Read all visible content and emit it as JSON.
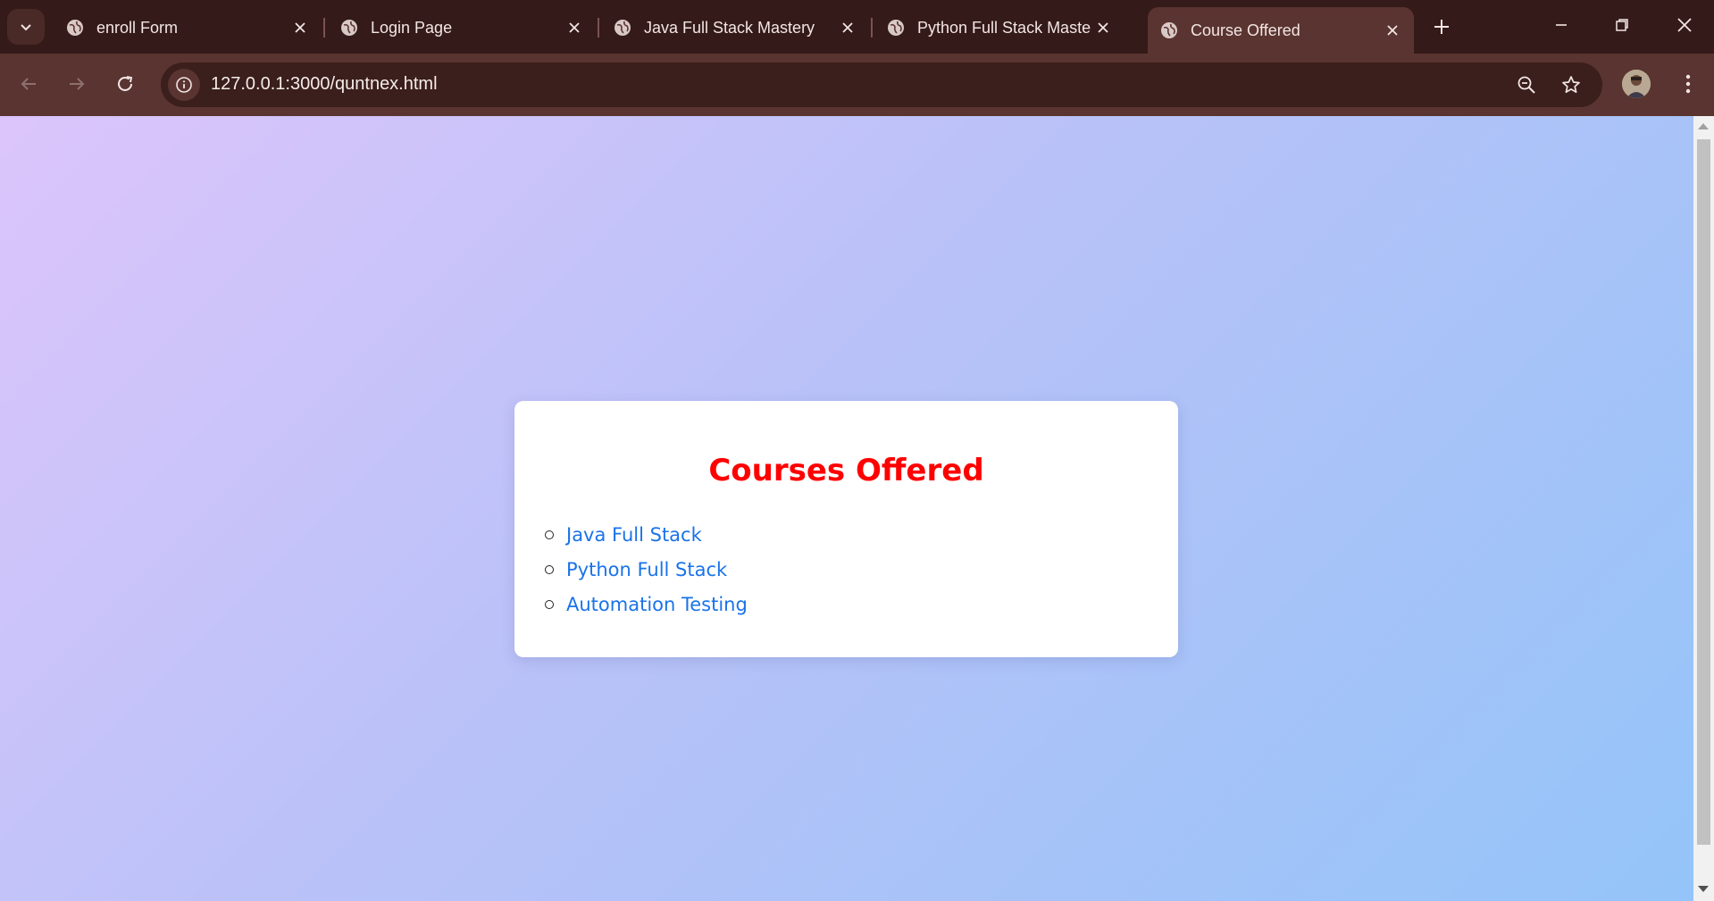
{
  "browser": {
    "tabs": [
      {
        "title": "enroll Form",
        "active": false
      },
      {
        "title": "Login Page",
        "active": false
      },
      {
        "title": "Java Full Stack Mastery",
        "active": false
      },
      {
        "title": "Python Full Stack Mastery",
        "active": false
      },
      {
        "title": "Course Offered",
        "active": true
      }
    ],
    "url": "127.0.0.1:3000/quntnex.html",
    "icons": {
      "tab_search": "chevron-down-icon",
      "favicon": "globe-icon",
      "close": "close-icon",
      "new_tab": "plus-icon",
      "minimize": "minimize-icon",
      "restore": "restore-icon",
      "window_close": "close-icon",
      "back": "back-arrow-icon",
      "forward": "forward-arrow-icon",
      "reload": "reload-icon",
      "site_info": "info-icon",
      "zoom": "zoom-icon",
      "bookmark": "star-icon",
      "menu": "kebab-menu-icon"
    }
  },
  "page": {
    "heading": "Courses Offered",
    "courses": [
      {
        "label": "Java Full Stack"
      },
      {
        "label": "Python Full Stack"
      },
      {
        "label": "Automation Testing"
      }
    ],
    "colors": {
      "heading": "#ff0000",
      "link": "#1a73e8",
      "card_bg": "#ffffff",
      "gradient_start": "#dcc5fb",
      "gradient_end": "#94c4f9"
    }
  }
}
